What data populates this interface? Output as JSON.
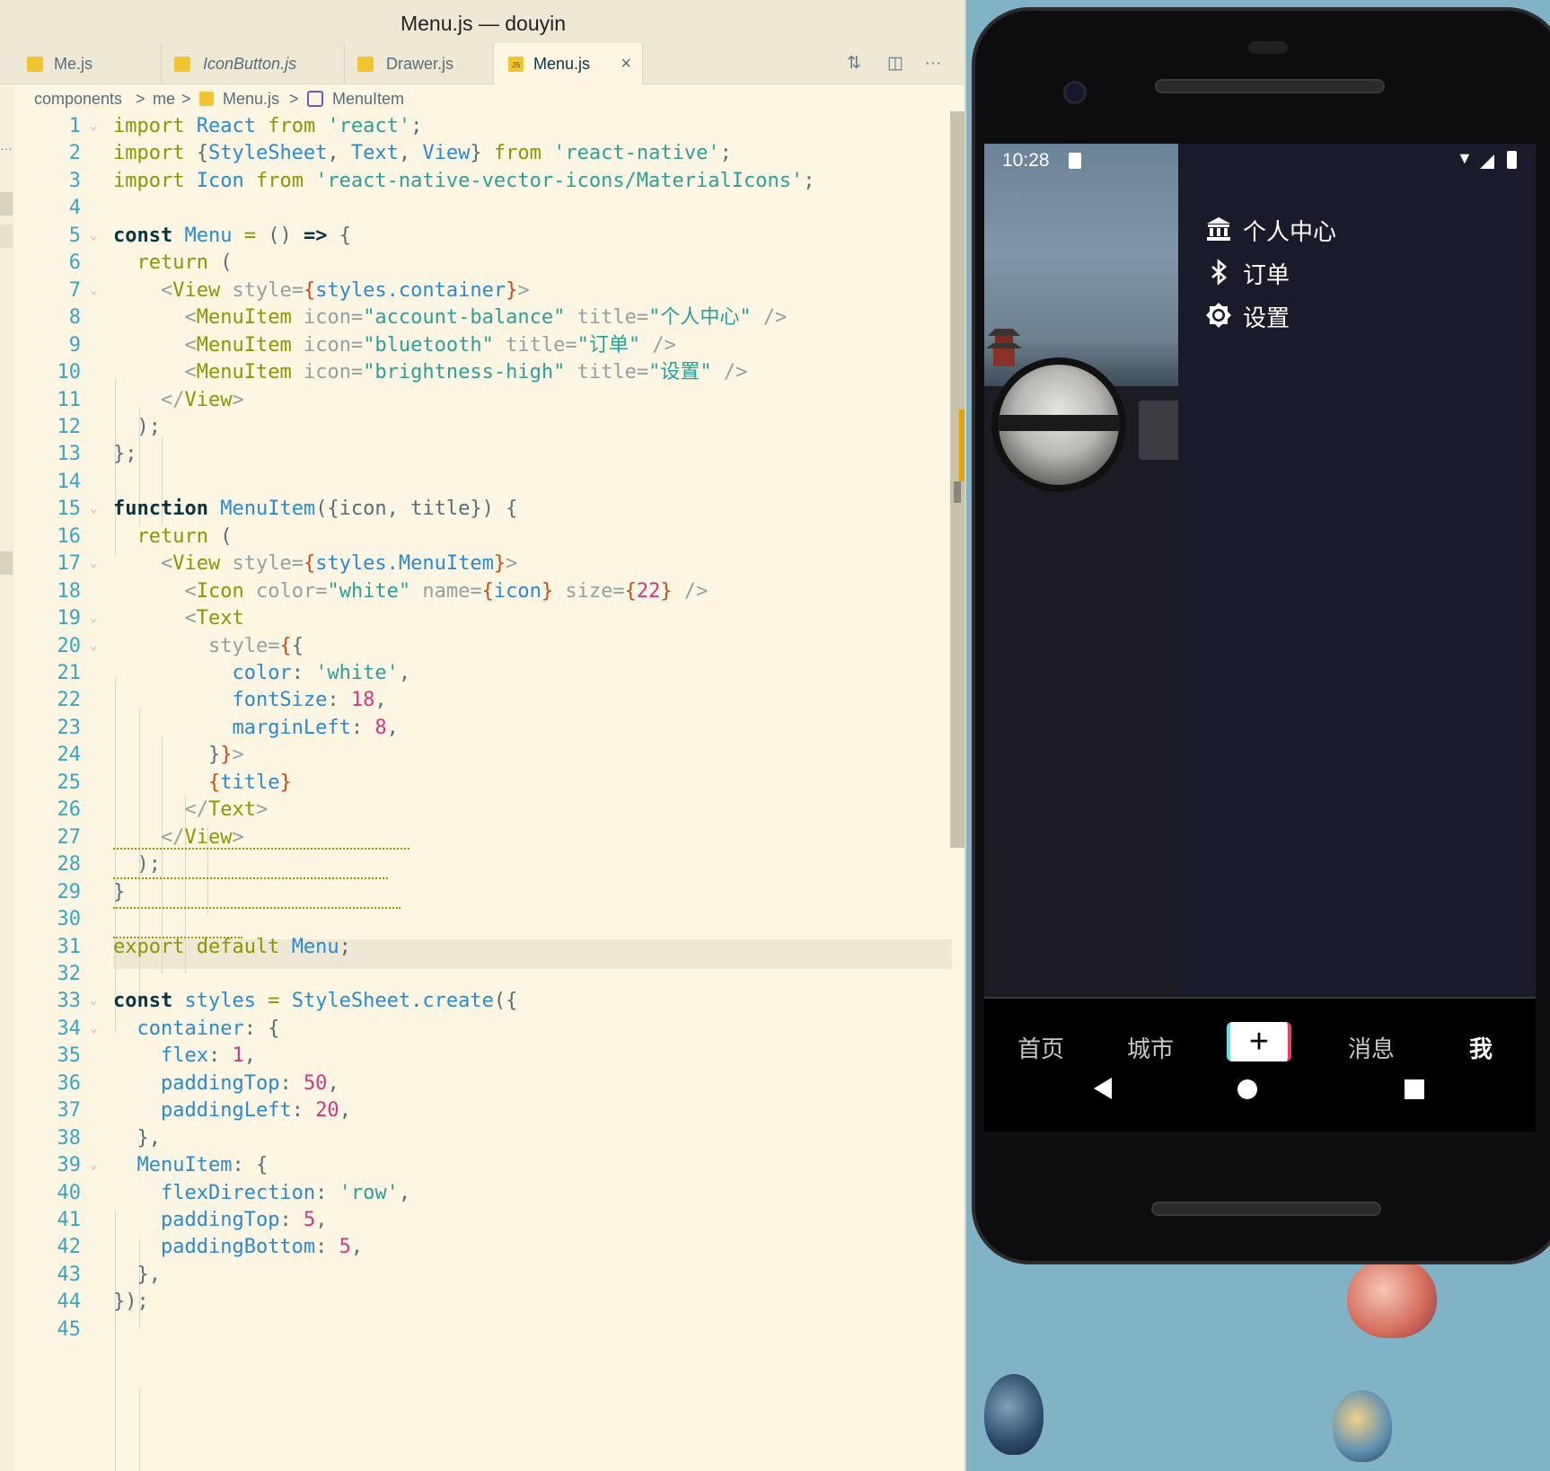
{
  "window": {
    "title": "Menu.js — douyin"
  },
  "tabs": [
    {
      "label": "Me.js",
      "italic": false,
      "active": false
    },
    {
      "label": "IconButton.js",
      "italic": true,
      "active": false
    },
    {
      "label": "Drawer.js",
      "italic": false,
      "active": false
    },
    {
      "label": "Menu.js",
      "italic": false,
      "active": true
    }
  ],
  "tab_close_glyph": "×",
  "toolbar": {
    "compare_icon": "⇅",
    "split_icon": "◫",
    "more_icon": "···"
  },
  "breadcrumb": {
    "folder1": "components",
    "folder2": "me",
    "file": "Menu.js",
    "symbol": "MenuItem",
    "sep": ">"
  },
  "left_gutter_glyph": "…",
  "code_lines": [
    {
      "n": "1"
    },
    {
      "n": "2"
    },
    {
      "n": "3"
    },
    {
      "n": "4"
    },
    {
      "n": "5"
    },
    {
      "n": "6"
    },
    {
      "n": "7"
    },
    {
      "n": "8"
    },
    {
      "n": "9"
    },
    {
      "n": "10"
    },
    {
      "n": "11"
    },
    {
      "n": "12"
    },
    {
      "n": "13"
    },
    {
      "n": "14"
    },
    {
      "n": "15"
    },
    {
      "n": "16"
    },
    {
      "n": "17"
    },
    {
      "n": "18"
    },
    {
      "n": "19"
    },
    {
      "n": "20"
    },
    {
      "n": "21"
    },
    {
      "n": "22"
    },
    {
      "n": "23"
    },
    {
      "n": "24"
    },
    {
      "n": "25"
    },
    {
      "n": "26"
    },
    {
      "n": "27"
    },
    {
      "n": "28"
    },
    {
      "n": "29"
    },
    {
      "n": "30"
    },
    {
      "n": "31"
    },
    {
      "n": "32"
    },
    {
      "n": "33"
    },
    {
      "n": "34"
    },
    {
      "n": "35"
    },
    {
      "n": "36"
    },
    {
      "n": "37"
    },
    {
      "n": "38"
    },
    {
      "n": "39"
    },
    {
      "n": "40"
    },
    {
      "n": "41"
    },
    {
      "n": "42"
    },
    {
      "n": "43"
    },
    {
      "n": "44"
    },
    {
      "n": "45"
    }
  ],
  "code": {
    "l1": [
      [
        "kw",
        "import "
      ],
      [
        "id",
        "React "
      ],
      [
        "kw",
        "from "
      ],
      [
        "str",
        "'react'"
      ],
      [
        "pu",
        ";"
      ]
    ],
    "l2": [
      [
        "kw",
        "import "
      ],
      [
        "pu",
        "{"
      ],
      [
        "id",
        "StyleSheet"
      ],
      [
        "pu",
        ", "
      ],
      [
        "id",
        "Text"
      ],
      [
        "pu",
        ", "
      ],
      [
        "id",
        "View"
      ],
      [
        "pu",
        "} "
      ],
      [
        "kw",
        "from "
      ],
      [
        "str",
        "'react-native'"
      ],
      [
        "pu",
        ";"
      ]
    ],
    "l3": [
      [
        "kw",
        "import "
      ],
      [
        "id",
        "Icon "
      ],
      [
        "kw",
        "from "
      ],
      [
        "str",
        "'react-native-vector-icons/MaterialIcons'"
      ],
      [
        "pu",
        ";"
      ]
    ],
    "l4": [],
    "l5": [
      [
        "kb",
        "const "
      ],
      [
        "id",
        "Menu "
      ],
      [
        "kw",
        "= "
      ],
      [
        "pu",
        "() "
      ],
      [
        "kb",
        "=> "
      ],
      [
        "pu",
        "{"
      ]
    ],
    "l6": [
      [
        "pu",
        "  "
      ],
      [
        "kw",
        "return "
      ],
      [
        "pu",
        "("
      ]
    ],
    "l7": [
      [
        "pu",
        "    "
      ],
      [
        "at",
        "<"
      ],
      [
        "tag",
        "View "
      ],
      [
        "at",
        "style="
      ],
      [
        "br",
        "{"
      ],
      [
        "id",
        "styles.container"
      ],
      [
        "br",
        "}"
      ],
      [
        "at",
        ">"
      ]
    ],
    "l8": [
      [
        "pu",
        "      "
      ],
      [
        "at",
        "<"
      ],
      [
        "tag",
        "MenuItem "
      ],
      [
        "at",
        "icon="
      ],
      [
        "str",
        "\"account-balance\" "
      ],
      [
        "at",
        "title="
      ],
      [
        "str",
        "\"个人中心\" "
      ],
      [
        "at",
        "/>"
      ]
    ],
    "l9": [
      [
        "pu",
        "      "
      ],
      [
        "at",
        "<"
      ],
      [
        "tag",
        "MenuItem "
      ],
      [
        "at",
        "icon="
      ],
      [
        "str",
        "\"bluetooth\" "
      ],
      [
        "at",
        "title="
      ],
      [
        "str",
        "\"订单\" "
      ],
      [
        "at",
        "/>"
      ]
    ],
    "l10": [
      [
        "pu",
        "      "
      ],
      [
        "at",
        "<"
      ],
      [
        "tag",
        "MenuItem "
      ],
      [
        "at",
        "icon="
      ],
      [
        "str",
        "\"brightness-high\" "
      ],
      [
        "at",
        "title="
      ],
      [
        "str",
        "\"设置\" "
      ],
      [
        "at",
        "/>"
      ]
    ],
    "l11": [
      [
        "pu",
        "    "
      ],
      [
        "at",
        "</"
      ],
      [
        "tag",
        "View"
      ],
      [
        "at",
        ">"
      ]
    ],
    "l12": [
      [
        "pu",
        "  );"
      ]
    ],
    "l13": [
      [
        "pu",
        "};"
      ]
    ],
    "l14": [],
    "l15": [
      [
        "kb",
        "function "
      ],
      [
        "id",
        "MenuItem"
      ],
      [
        "pu",
        "({icon, title}) {"
      ]
    ],
    "l16": [
      [
        "pu",
        "  "
      ],
      [
        "kw",
        "return "
      ],
      [
        "pu",
        "("
      ]
    ],
    "l17": [
      [
        "pu",
        "    "
      ],
      [
        "at",
        "<"
      ],
      [
        "tag",
        "View "
      ],
      [
        "at",
        "style="
      ],
      [
        "br",
        "{"
      ],
      [
        "id",
        "styles.MenuItem"
      ],
      [
        "br",
        "}"
      ],
      [
        "at",
        ">"
      ]
    ],
    "l18": [
      [
        "pu",
        "      "
      ],
      [
        "at",
        "<"
      ],
      [
        "tag",
        "Icon "
      ],
      [
        "at",
        "color="
      ],
      [
        "str",
        "\"white\" "
      ],
      [
        "at",
        "name="
      ],
      [
        "br",
        "{"
      ],
      [
        "id",
        "icon"
      ],
      [
        "br",
        "} "
      ],
      [
        "at",
        "size="
      ],
      [
        "br",
        "{"
      ],
      [
        "num",
        "22"
      ],
      [
        "br",
        "} "
      ],
      [
        "at",
        "/>"
      ]
    ],
    "l19": [
      [
        "pu",
        "      "
      ],
      [
        "at",
        "<"
      ],
      [
        "tag",
        "Text"
      ]
    ],
    "l20": [
      [
        "pu",
        "        "
      ],
      [
        "at",
        "style="
      ],
      [
        "br",
        "{"
      ],
      [
        "pu",
        "{"
      ]
    ],
    "l21": [
      [
        "pu",
        "          "
      ],
      [
        "id",
        "color"
      ],
      [
        "pu",
        ": "
      ],
      [
        "str",
        "'white'"
      ],
      [
        "pu",
        ","
      ]
    ],
    "l22": [
      [
        "pu",
        "          "
      ],
      [
        "id",
        "fontSize"
      ],
      [
        "pu",
        ": "
      ],
      [
        "num",
        "18"
      ],
      [
        "pu",
        ","
      ]
    ],
    "l23": [
      [
        "pu",
        "          "
      ],
      [
        "id",
        "marginLeft"
      ],
      [
        "pu",
        ": "
      ],
      [
        "num",
        "8"
      ],
      [
        "pu",
        ","
      ]
    ],
    "l24": [
      [
        "pu",
        "        }"
      ],
      [
        "br",
        "}"
      ],
      [
        "at",
        ">"
      ]
    ],
    "l25": [
      [
        "pu",
        "        "
      ],
      [
        "br",
        "{"
      ],
      [
        "id",
        "title"
      ],
      [
        "br",
        "}"
      ]
    ],
    "l26": [
      [
        "pu",
        "      "
      ],
      [
        "at",
        "</"
      ],
      [
        "tag",
        "Text"
      ],
      [
        "at",
        ">"
      ]
    ],
    "l27": [
      [
        "pu",
        "    "
      ],
      [
        "at",
        "</"
      ],
      [
        "tag",
        "View"
      ],
      [
        "at",
        ">"
      ]
    ],
    "l28": [
      [
        "pu",
        "  );"
      ]
    ],
    "l29": [
      [
        "pu",
        "}"
      ]
    ],
    "l30": [],
    "l31": [
      [
        "kw",
        "export default "
      ],
      [
        "id",
        "Menu"
      ],
      [
        "pu",
        ";"
      ]
    ],
    "l32": [],
    "l33": [
      [
        "kb",
        "const "
      ],
      [
        "id",
        "styles "
      ],
      [
        "kw",
        "= "
      ],
      [
        "id",
        "StyleSheet"
      ],
      [
        "pu",
        "."
      ],
      [
        "id",
        "create"
      ],
      [
        "pu",
        "({"
      ]
    ],
    "l34": [
      [
        "pu",
        "  "
      ],
      [
        "id",
        "container"
      ],
      [
        "pu",
        ": {"
      ]
    ],
    "l35": [
      [
        "pu",
        "    "
      ],
      [
        "id",
        "flex"
      ],
      [
        "pu",
        ": "
      ],
      [
        "num",
        "1"
      ],
      [
        "pu",
        ","
      ]
    ],
    "l36": [
      [
        "pu",
        "    "
      ],
      [
        "id",
        "paddingTop"
      ],
      [
        "pu",
        ": "
      ],
      [
        "num",
        "50"
      ],
      [
        "pu",
        ","
      ]
    ],
    "l37": [
      [
        "pu",
        "    "
      ],
      [
        "id",
        "paddingLeft"
      ],
      [
        "pu",
        ": "
      ],
      [
        "num",
        "20"
      ],
      [
        "pu",
        ","
      ]
    ],
    "l38": [
      [
        "pu",
        "  },"
      ]
    ],
    "l39": [
      [
        "pu",
        "  "
      ],
      [
        "id",
        "MenuItem"
      ],
      [
        "pu",
        ": {"
      ]
    ],
    "l40": [
      [
        "pu",
        "    "
      ],
      [
        "id",
        "flexDirection"
      ],
      [
        "pu",
        ": "
      ],
      [
        "str",
        "'row'"
      ],
      [
        "pu",
        ","
      ]
    ],
    "l41": [
      [
        "pu",
        "    "
      ],
      [
        "id",
        "paddingTop"
      ],
      [
        "pu",
        ": "
      ],
      [
        "num",
        "5"
      ],
      [
        "pu",
        ","
      ]
    ],
    "l42": [
      [
        "pu",
        "    "
      ],
      [
        "id",
        "paddingBottom"
      ],
      [
        "pu",
        ": "
      ],
      [
        "num",
        "5"
      ],
      [
        "pu",
        ","
      ]
    ],
    "l43": [
      [
        "pu",
        "  },"
      ]
    ],
    "l44": [
      [
        "pu",
        "});"
      ]
    ],
    "l45": []
  },
  "phone": {
    "time": "10:28",
    "wifi_icon": "▼",
    "menu_items": [
      {
        "icon": "account-balance-icon",
        "glyph": "🏛",
        "label": "个人中心"
      },
      {
        "icon": "bluetooth-icon",
        "glyph": "✱",
        "label": "订单"
      },
      {
        "icon": "brightness-high-icon",
        "glyph": "✹",
        "label": "设置"
      }
    ],
    "tabs": [
      {
        "label": "首页",
        "selected": false
      },
      {
        "label": "城市",
        "selected": false
      },
      {
        "label": "消息",
        "selected": false
      },
      {
        "label": "我",
        "selected": true
      }
    ],
    "plus_label": "+"
  },
  "colors": {
    "keyword": "#859900",
    "identifier": "#268bd2",
    "string": "#2aa198",
    "number": "#d33682",
    "editor_bg": "#fdf6e3",
    "drawer_bg": "#1a1b2a"
  }
}
